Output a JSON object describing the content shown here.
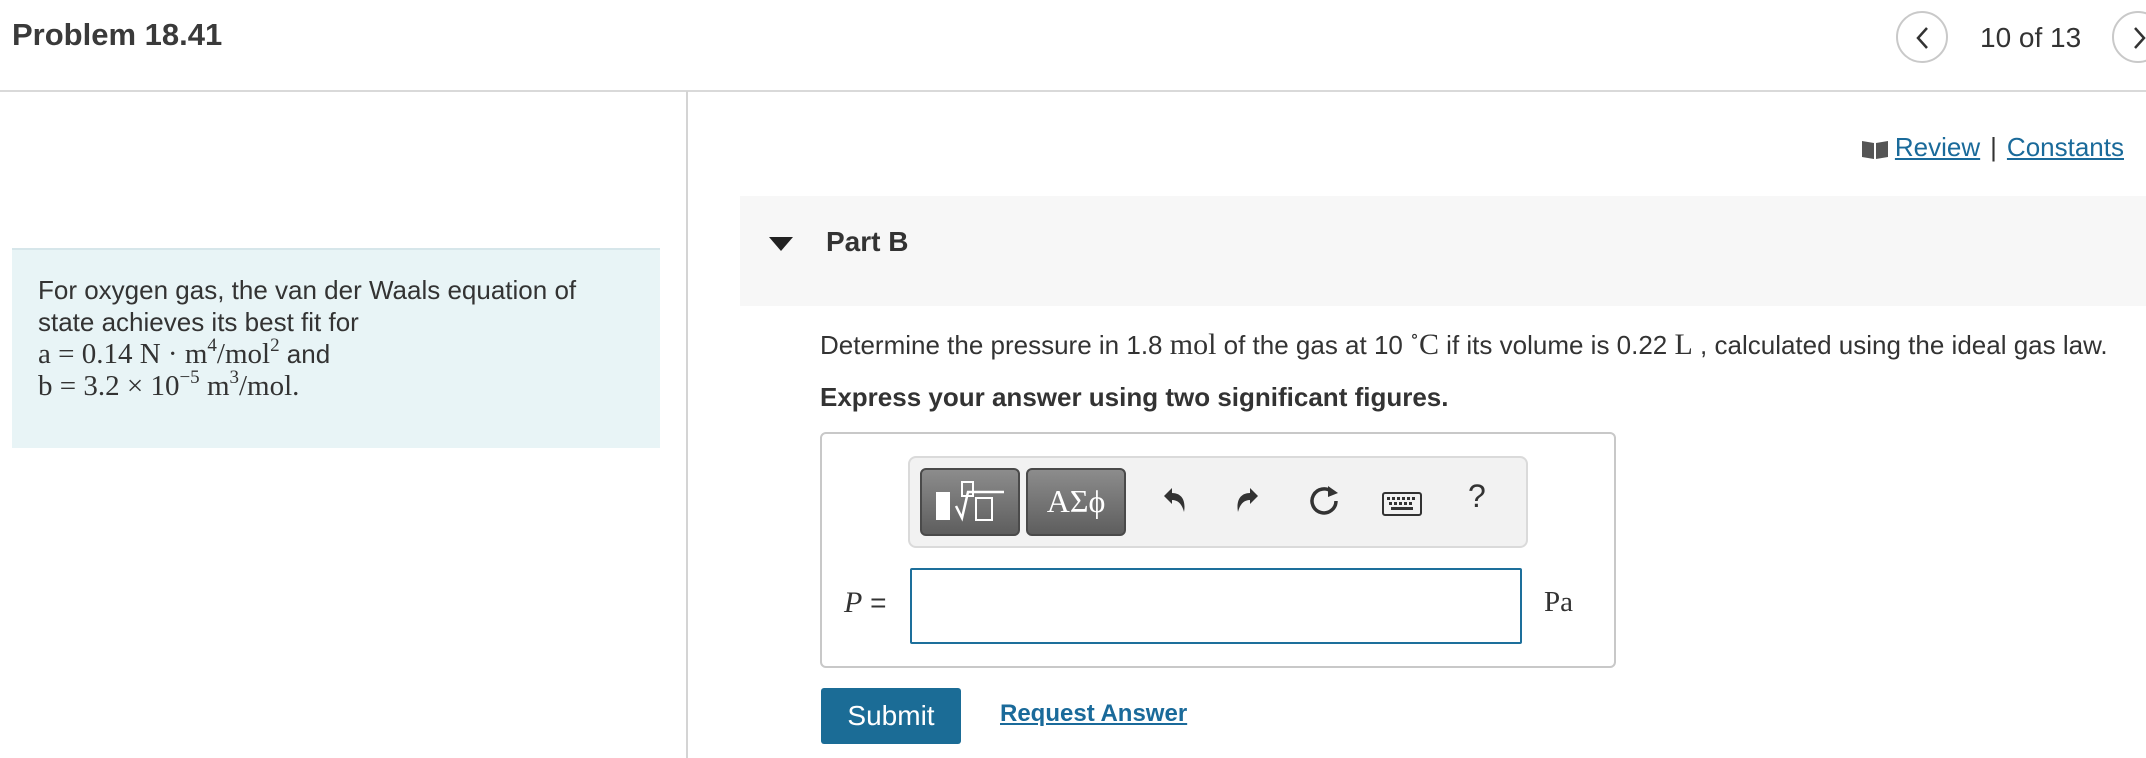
{
  "header": {
    "title": "Problem 18.41",
    "counter": "10 of 13"
  },
  "problem": {
    "line1": "For oxygen gas, the van der Waals equation of",
    "line2": "state achieves its best fit for",
    "a_expr": "a = 0.14 N · m",
    "a_exp1": "4",
    "a_mid": "/mol",
    "a_exp2": "2",
    "a_and": " and",
    "b_expr": "b = 3.2 × 10",
    "b_exp1": "−5",
    "b_mid": " m",
    "b_exp2": "3",
    "b_end": "/mol."
  },
  "links": {
    "review": "Review",
    "separator": "|",
    "constants": "Constants"
  },
  "part": {
    "label": "Part B"
  },
  "question": {
    "t1": "Determine the pressure in 1.8 ",
    "unit_mol": "mol",
    "t2": " of the gas at 10 ",
    "deg": "∘",
    "unit_c": "C",
    "t3": " if its volume is 0.22 ",
    "unit_l": "L",
    "t4": " , calculated using the ideal gas law.",
    "instruction": "Express your answer using two significant figures."
  },
  "toolbar": {
    "symbols_label": "ΑΣϕ",
    "help_label": "?",
    "icons": [
      "templates-icon",
      "undo-icon",
      "redo-icon",
      "reset-icon",
      "keyboard-icon",
      "help-icon"
    ]
  },
  "answer": {
    "variable": "P",
    "equals": " =",
    "value": "",
    "unit": "Pa"
  },
  "actions": {
    "submit": "Submit",
    "request_answer": "Request Answer"
  },
  "colors": {
    "accent": "#1b6c96",
    "link": "#1a6a9a",
    "problem_bg": "#e8f4f6"
  }
}
